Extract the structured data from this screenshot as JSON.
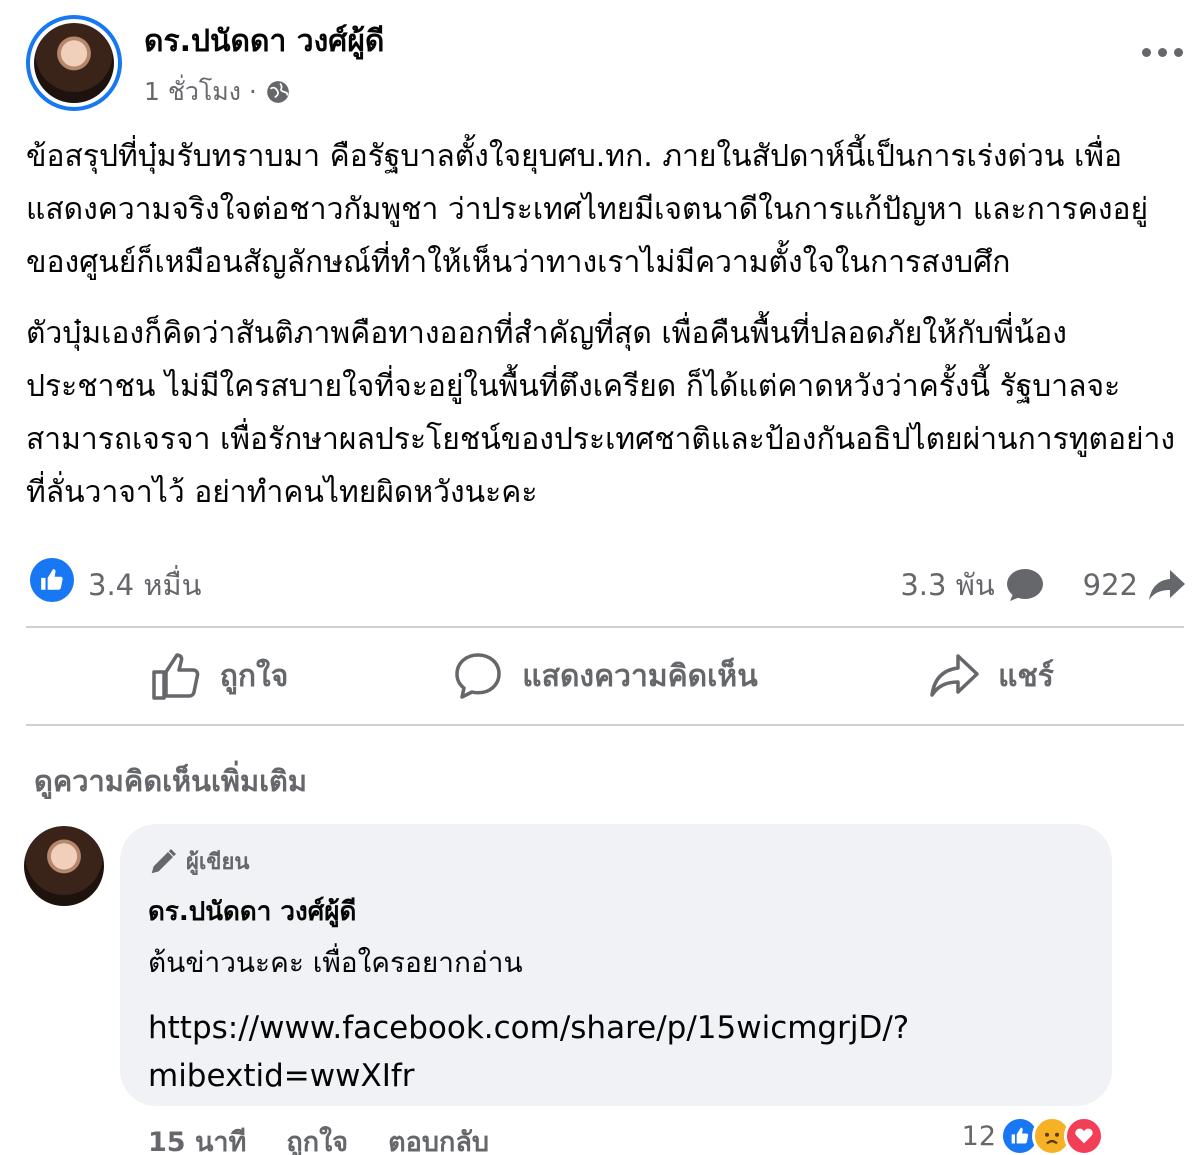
{
  "post": {
    "author": "ดร.ปนัดดา วงศ์ผู้ดี",
    "time": "1 ชั่วโมง ·",
    "paragraphs": [
      "ข้อสรุปที่บุ๋มรับทราบมา คือรัฐบาลตั้งใจยุบศบ.ทก. ภายในสัปดาห์นี้เป็นการเร่งด่วน เพื่อแสดงความจริงใจต่อชาวกัมพูชา ว่าประเทศไทยมีเจตนาดีในการแก้ปัญหา และการคงอยู่ของศูนย์ก็เหมือนสัญลักษณ์ที่ทำให้เห็นว่าทางเราไม่มีความตั้งใจในการสงบศึก",
      "ตัวบุ๋มเองก็คิดว่าสันติภาพคือทางออกที่สำคัญที่สุด เพื่อคืนพื้นที่ปลอดภัยให้กับพี่น้องประชาชน ไม่มีใครสบายใจที่จะอยู่ในพื้นที่ตึงเครียด ก็ได้แต่คาดหวังว่าครั้งนี้ รัฐบาลจะสามารถเจรจา เพื่อรักษาผลประโยชน์ของประเทศชาติและป้องกันอธิปไตยผ่านการทูตอย่างที่ลั่นวาจาไว้ อย่าทำคนไทยผิดหวังนะคะ"
    ],
    "likes": "3.4 หมื่น",
    "comments": "3.3 พัน",
    "shares": "922"
  },
  "actions": {
    "like": "ถูกใจ",
    "comment": "แสดงความคิดเห็น",
    "share": "แชร์"
  },
  "more_comments": "ดูความคิดเห็นเพิ่มเติม",
  "comment": {
    "badge": "ผู้เขียน",
    "author": "ดร.ปนัดดา วงศ์ผู้ดี",
    "text": "ต้นข่าวนะคะ เพื่อใครอยากอ่าน",
    "link_line1": "https://www.facebook.com/share/p/15wicmgrjD/?",
    "link_line2": "mibextid=wwXIfr",
    "time": "15 นาที",
    "like": "ถูกใจ",
    "reply": "ตอบกลับ",
    "reaction_count": "12"
  },
  "colors": {
    "accent": "#1877f2",
    "secondary_text": "#65676b",
    "bubble_bg": "#f0f2f5"
  }
}
